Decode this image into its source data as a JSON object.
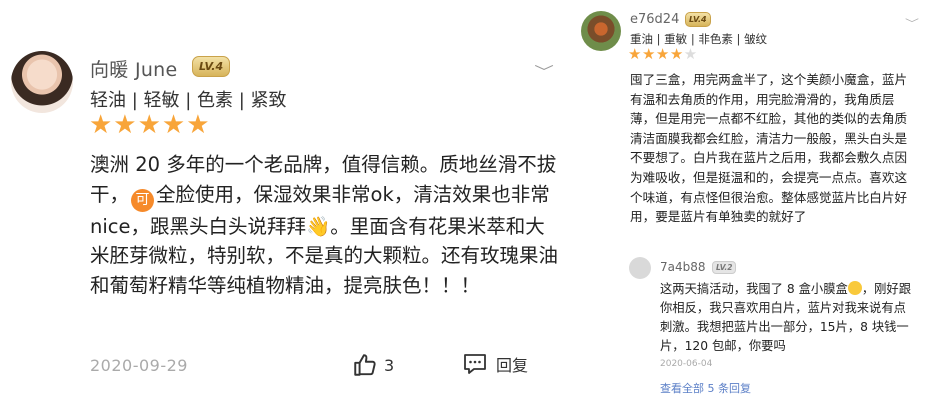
{
  "left_review": {
    "username": "向暖 June",
    "level": "LV.4",
    "tags": "轻油 | 轻敏 | 色素 | 紧致",
    "stars": "★★★★★",
    "content": {
      "p1": "澳洲 20 多年的一个老品牌，值得信赖。质地丝滑不拔干，",
      "badge": "可",
      "p2": "全脸使用，保湿效果非常ok，清洁效果也非常 nice，跟黑头白头说拜拜👋。里面含有花果米萃和大米胚芽微粒，特别软，不是真的大颗粒。还有玫瑰果油和葡萄籽精华等纯植物精油，提亮肤色！！！"
    },
    "date": "2020-09-29",
    "like_count": "3",
    "reply_label": "回复"
  },
  "right_review": {
    "username": "e76d24",
    "level": "LV.4",
    "tags": "重油 | 重敏 | 非色素 | 皱纹",
    "rating": 4,
    "stars_on": "★★★★",
    "stars_off": "★",
    "content": "囤了三盒，用完两盒半了，这个美颜小魔盒，蓝片有温和去角质的作用，用完脸滑滑的，我角质层薄，但是用完一点都不红脸，其他的类似的去角质清洁面膜我都会红脸，清洁力一般般，黑头白头是不要想了。白片我在蓝片之后用，我都会敷久点因为难吸收，但是挺温和的，会提亮一点点。喜欢这个味道，有点怪但很治愈。整体感觉蓝片比白片好用，要是蓝片有单独卖的就好了",
    "reply": {
      "username": "7a4b88",
      "level": "LV.2",
      "text_before": "这两天搞活动，我囤了 8 盒小膜盒",
      "text_after": "，刚好跟你相反，我只喜欢用白片，蓝片对我来说有点刺激。我想把蓝片出一部分，15片，8 块钱一片，120 包邮，你要吗",
      "date": "2020-06-04",
      "view_all": "查看全部 5 条回复"
    }
  },
  "icons": {
    "like": "thumbs-up-icon",
    "reply": "comment-icon",
    "menu": "chevron-down-icon",
    "emoji": "grin-sweat-icon"
  },
  "colors": {
    "star": "#f8a53a",
    "badge_gold": "#d7b45b",
    "link": "#5b7fc7",
    "reply_badge": "#f68a2a"
  }
}
